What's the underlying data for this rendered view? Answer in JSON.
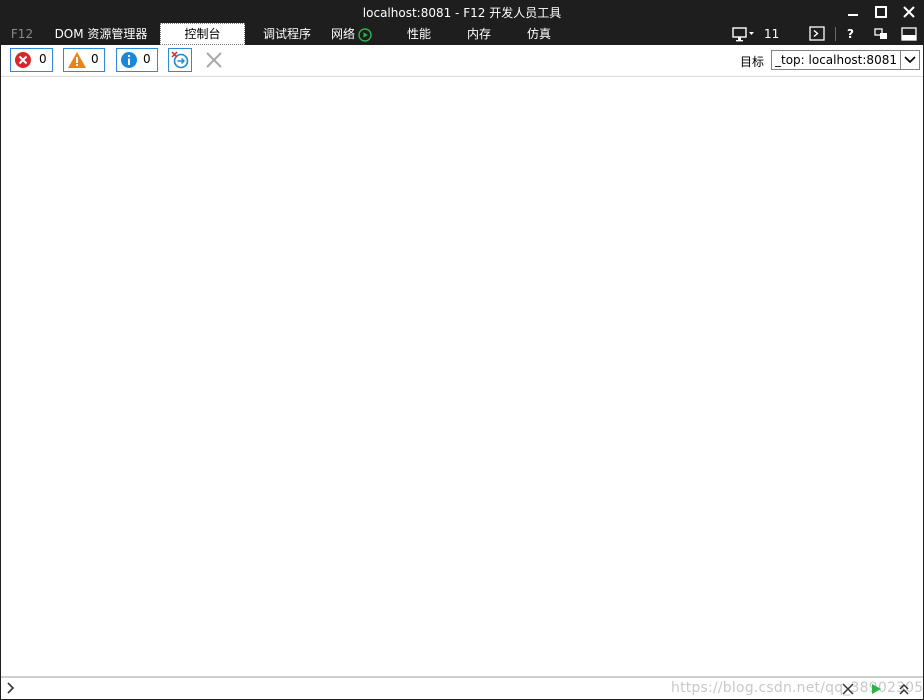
{
  "window": {
    "title": "localhost:8081 - F12 开发人员工具"
  },
  "tabs": [
    {
      "label": "F12"
    },
    {
      "label": "DOM 资源管理器"
    },
    {
      "label": "控制台"
    },
    {
      "label": "调试程序"
    },
    {
      "label": "网络"
    },
    {
      "label": "性能"
    },
    {
      "label": "内存"
    },
    {
      "label": "仿真"
    }
  ],
  "active_tab": "控制台",
  "tabbar_right": {
    "emulation_mode": "11",
    "help_label": "?"
  },
  "toolbar": {
    "errors_count": "0",
    "warnings_count": "0",
    "info_count": "0",
    "target_label": "目标",
    "target_value": "_top: localhost:8081"
  },
  "inputbar": {
    "watermark": "https://blog.csdn.net/qq_38902305"
  },
  "colors": {
    "chrome_bg": "#1e1e1e",
    "accent_blue": "#2f8bd6",
    "error_red": "#d9262d",
    "warning_orange": "#e8841a",
    "info_blue": "#1a88d8",
    "run_green": "#2db34a"
  }
}
